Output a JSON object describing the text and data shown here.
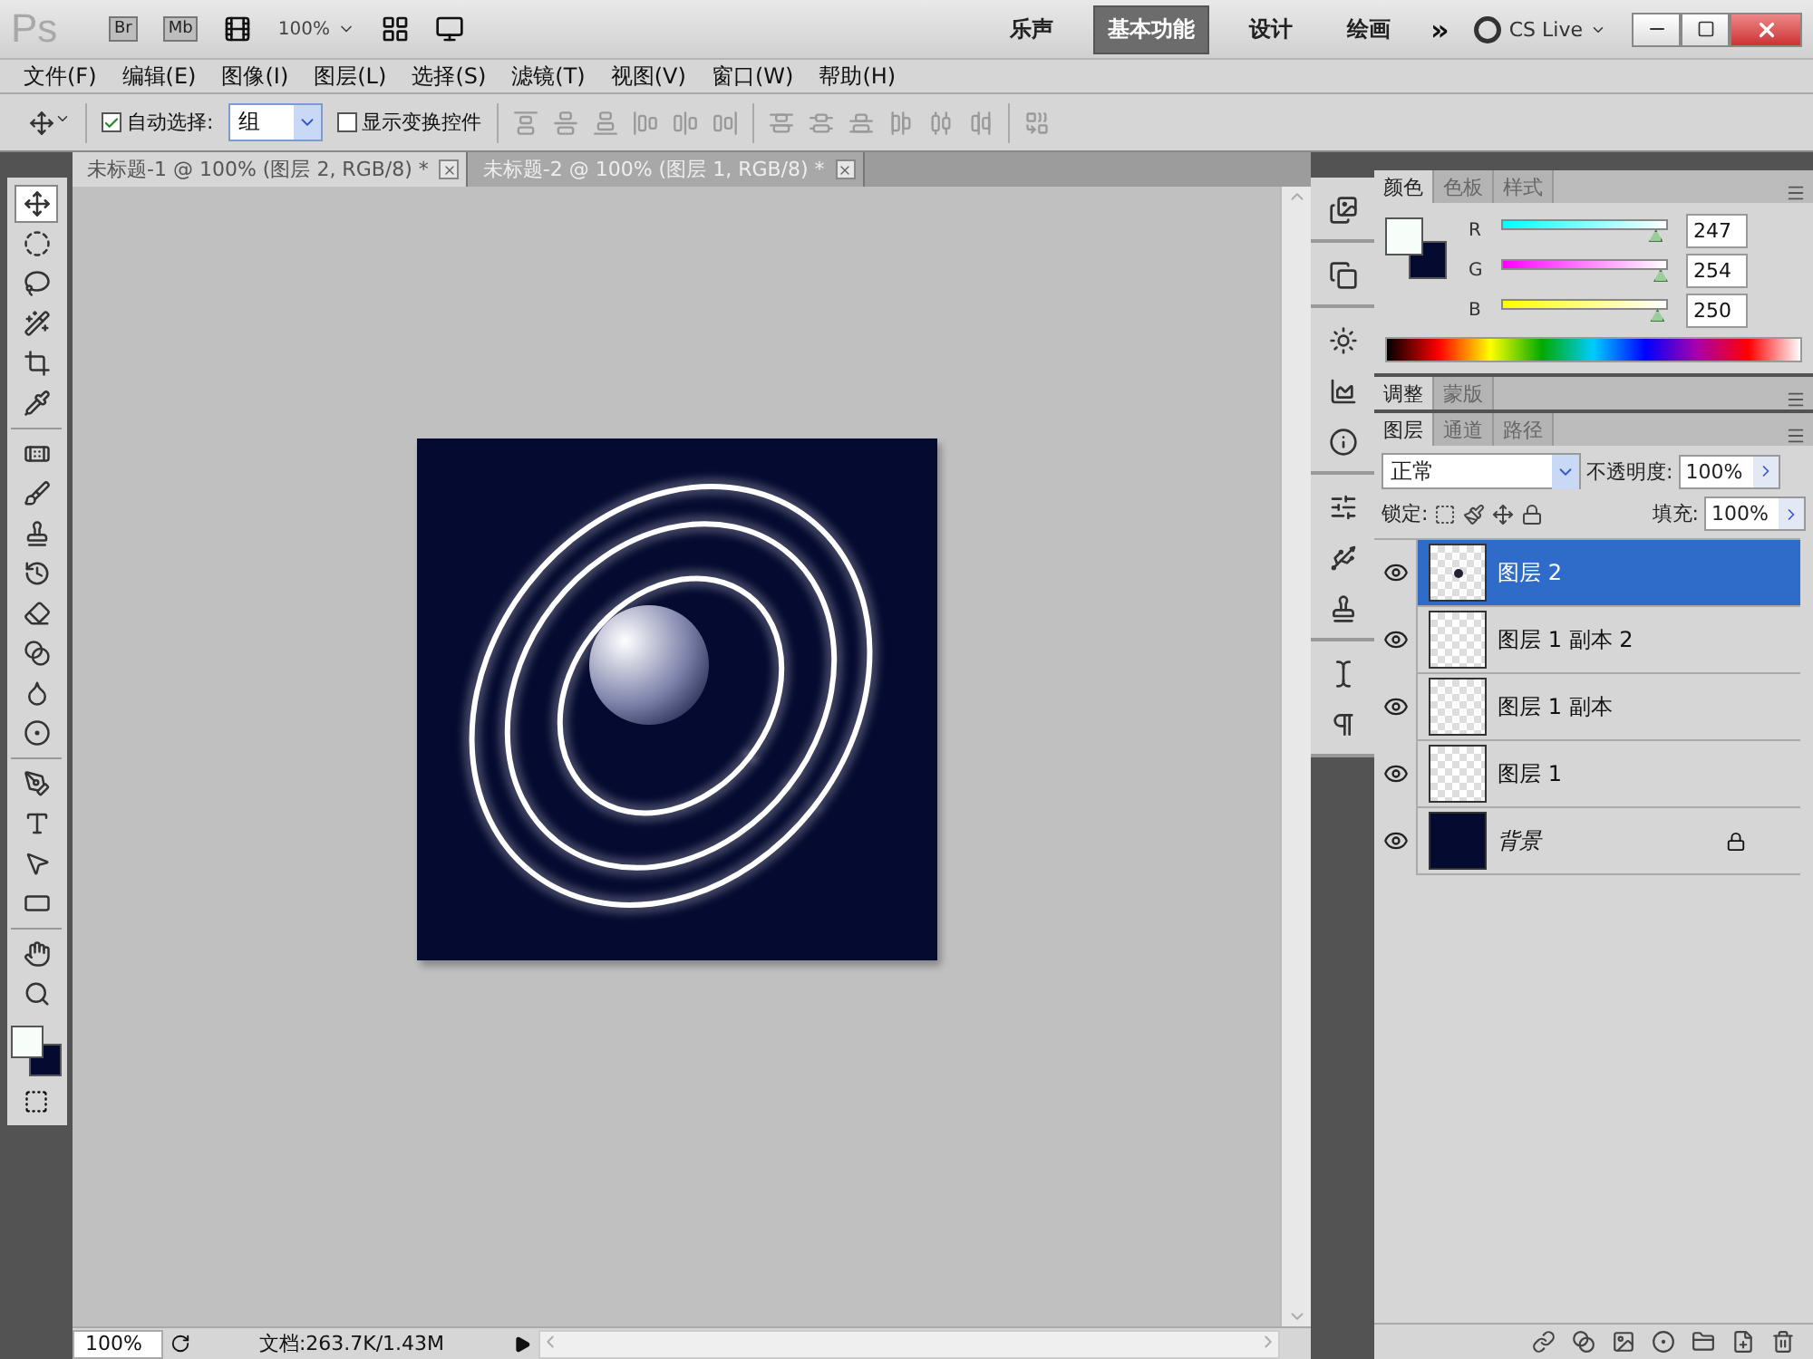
{
  "app": {
    "logo": "Ps",
    "bridge": "Br",
    "mini_bridge": "Mb",
    "zoom": "100%"
  },
  "workspaces": [
    {
      "label": "乐声",
      "selected": false
    },
    {
      "label": "基本功能",
      "selected": true
    },
    {
      "label": "设计",
      "selected": false
    },
    {
      "label": "绘画",
      "selected": false
    }
  ],
  "more": "»",
  "cs_live": "CS Live",
  "menu": [
    "文件(F)",
    "编辑(E)",
    "图像(I)",
    "图层(L)",
    "选择(S)",
    "滤镜(T)",
    "视图(V)",
    "窗口(W)",
    "帮助(H)"
  ],
  "options": {
    "auto_select": {
      "label": "自动选择:",
      "checked": true,
      "value": "组"
    },
    "transform_controls": {
      "label": "显示变换控件",
      "checked": false
    }
  },
  "documents": [
    {
      "title": "未标题-1 @ 100% (图层 2, RGB/8) *",
      "selected": true
    },
    {
      "title": "未标题-2 @ 100% (图层 1, RGB/8) *",
      "selected": false
    }
  ],
  "tool_groups": [
    [
      {
        "kind": "move",
        "selected": true
      },
      {
        "kind": "marquee",
        "selected": false
      },
      {
        "kind": "lasso",
        "selected": false
      },
      {
        "kind": "wand",
        "selected": false
      },
      {
        "kind": "crop",
        "selected": false
      },
      {
        "kind": "eyedropper",
        "selected": false
      }
    ],
    [
      {
        "kind": "healing",
        "selected": false
      },
      {
        "kind": "brush",
        "selected": false
      },
      {
        "kind": "stamp",
        "selected": false
      },
      {
        "kind": "history",
        "selected": false
      },
      {
        "kind": "eraser",
        "selected": false
      },
      {
        "kind": "gradient",
        "selected": false
      },
      {
        "kind": "blur",
        "selected": false
      },
      {
        "kind": "dodge",
        "selected": false
      }
    ],
    [
      {
        "kind": "pen",
        "selected": false
      },
      {
        "kind": "type",
        "selected": false
      },
      {
        "kind": "path",
        "selected": false
      },
      {
        "kind": "shape",
        "selected": false
      }
    ],
    [
      {
        "kind": "hand",
        "selected": false
      },
      {
        "kind": "zoom",
        "selected": false
      }
    ]
  ],
  "color_panel": {
    "tabs": [
      {
        "label": "颜色",
        "selected": true
      },
      {
        "label": "色板",
        "selected": false
      },
      {
        "label": "样式",
        "selected": false
      }
    ],
    "channels": [
      {
        "name": "R",
        "level": 0.97,
        "value": "247"
      },
      {
        "name": "G",
        "level": 1.0,
        "value": "254"
      },
      {
        "name": "B",
        "level": 0.98,
        "value": "250"
      }
    ]
  },
  "adjust_panel": {
    "tabs": [
      {
        "label": "调整",
        "selected": true
      },
      {
        "label": "蒙版",
        "selected": false
      }
    ]
  },
  "layers_panel": {
    "tabs": [
      {
        "label": "图层",
        "selected": true
      },
      {
        "label": "通道",
        "selected": false
      },
      {
        "label": "路径",
        "selected": false
      }
    ],
    "blend_mode": "正常",
    "opacity_label": "不透明度:",
    "opacity": "100%",
    "lock_label": "锁定:",
    "fill_label": "填充:",
    "fill": "100%",
    "layers": [
      {
        "name": "图层 2",
        "kind": "orb",
        "selected": true,
        "visible": true,
        "locked": false
      },
      {
        "name": "图层 1 副本 2",
        "kind": "empty",
        "selected": false,
        "visible": true,
        "locked": false
      },
      {
        "name": "图层 1 副本",
        "kind": "empty",
        "selected": false,
        "visible": true,
        "locked": false
      },
      {
        "name": "图层 1",
        "kind": "empty",
        "selected": false,
        "visible": true,
        "locked": false
      },
      {
        "name": "背景",
        "kind": "solid",
        "color": "#050a30",
        "selected": false,
        "visible": true,
        "locked": true
      }
    ]
  },
  "status": {
    "zoom": "100%",
    "doc_info": "文档:263.7K/1.43M"
  }
}
